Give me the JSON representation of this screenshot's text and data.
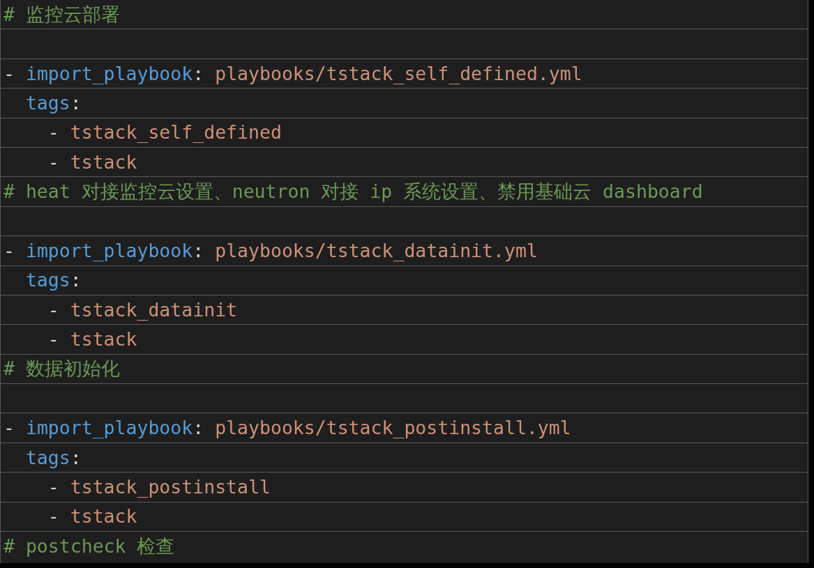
{
  "lines": [
    {
      "kind": "code",
      "tokens": [
        {
          "kind": "comment",
          "text": "# 监控云部署"
        }
      ]
    },
    {
      "kind": "blank"
    },
    {
      "kind": "code",
      "tokens": [
        {
          "kind": "punct",
          "text": "- "
        },
        {
          "kind": "key",
          "text": "import_playbook"
        },
        {
          "kind": "punct",
          "text": ": "
        },
        {
          "kind": "string",
          "text": "playbooks/tstack_self_defined.yml"
        }
      ]
    },
    {
      "kind": "code",
      "tokens": [
        {
          "kind": "key",
          "text": "  tags"
        },
        {
          "kind": "punct",
          "text": ":"
        }
      ]
    },
    {
      "kind": "code",
      "tokens": [
        {
          "kind": "punct",
          "text": "    - "
        },
        {
          "kind": "string",
          "text": "tstack_self_defined"
        }
      ]
    },
    {
      "kind": "code",
      "tokens": [
        {
          "kind": "punct",
          "text": "    - "
        },
        {
          "kind": "string",
          "text": "tstack"
        }
      ]
    },
    {
      "kind": "code",
      "tokens": [
        {
          "kind": "comment",
          "text": "# heat 对接监控云设置、neutron 对接 ip 系统设置、禁用基础云 dashboard"
        }
      ]
    },
    {
      "kind": "blank"
    },
    {
      "kind": "code",
      "tokens": [
        {
          "kind": "punct",
          "text": "- "
        },
        {
          "kind": "key",
          "text": "import_playbook"
        },
        {
          "kind": "punct",
          "text": ": "
        },
        {
          "kind": "string",
          "text": "playbooks/tstack_datainit.yml"
        }
      ]
    },
    {
      "kind": "code",
      "tokens": [
        {
          "kind": "key",
          "text": "  tags"
        },
        {
          "kind": "punct",
          "text": ":"
        }
      ]
    },
    {
      "kind": "code",
      "tokens": [
        {
          "kind": "punct",
          "text": "    - "
        },
        {
          "kind": "string",
          "text": "tstack_datainit"
        }
      ]
    },
    {
      "kind": "code",
      "tokens": [
        {
          "kind": "punct",
          "text": "    - "
        },
        {
          "kind": "string",
          "text": "tstack"
        }
      ]
    },
    {
      "kind": "code",
      "tokens": [
        {
          "kind": "comment",
          "text": "# 数据初始化"
        }
      ]
    },
    {
      "kind": "blank"
    },
    {
      "kind": "code",
      "tokens": [
        {
          "kind": "punct",
          "text": "- "
        },
        {
          "kind": "key",
          "text": "import_playbook"
        },
        {
          "kind": "punct",
          "text": ": "
        },
        {
          "kind": "string",
          "text": "playbooks/tstack_postinstall.yml"
        }
      ]
    },
    {
      "kind": "code",
      "tokens": [
        {
          "kind": "key",
          "text": "  tags"
        },
        {
          "kind": "punct",
          "text": ":"
        }
      ]
    },
    {
      "kind": "code",
      "tokens": [
        {
          "kind": "punct",
          "text": "    - "
        },
        {
          "kind": "string",
          "text": "tstack_postinstall"
        }
      ]
    },
    {
      "kind": "code",
      "tokens": [
        {
          "kind": "punct",
          "text": "    - "
        },
        {
          "kind": "string",
          "text": "tstack"
        }
      ]
    },
    {
      "kind": "code",
      "tokens": [
        {
          "kind": "comment",
          "text": "# postcheck 检查"
        }
      ]
    }
  ]
}
